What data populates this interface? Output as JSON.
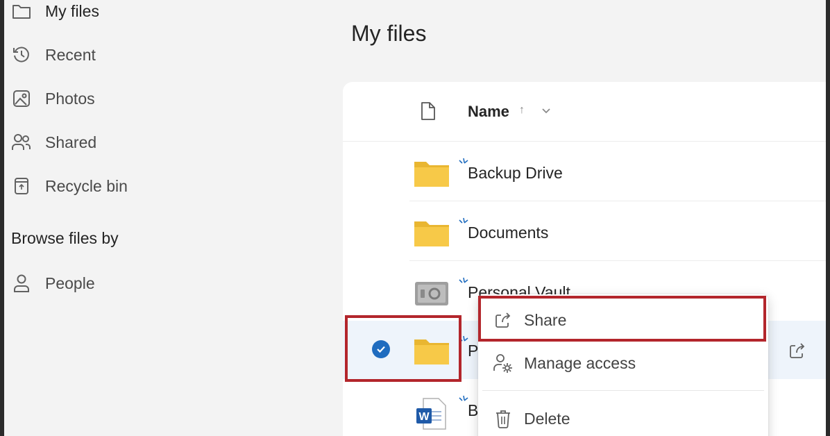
{
  "sidebar": {
    "items": [
      {
        "label": "My files",
        "icon": "folder-icon"
      },
      {
        "label": "Recent",
        "icon": "clock-icon"
      },
      {
        "label": "Photos",
        "icon": "image-icon"
      },
      {
        "label": "Shared",
        "icon": "people-icon"
      },
      {
        "label": "Recycle bin",
        "icon": "recycle-bin-icon"
      }
    ],
    "browse_heading": "Browse files by",
    "browse_items": [
      {
        "label": "People",
        "icon": "person-icon"
      }
    ]
  },
  "main": {
    "title": "My files",
    "columns": {
      "name": "Name",
      "sort_indicator": "↑"
    },
    "rows": [
      {
        "name": "Backup Drive",
        "type": "folder"
      },
      {
        "name": "Documents",
        "type": "folder"
      },
      {
        "name": "Personal Vault",
        "type": "vault"
      },
      {
        "name": "P",
        "type": "folder",
        "selected": true
      },
      {
        "name": "B",
        "type": "word-document"
      }
    ]
  },
  "context_menu": {
    "items": [
      {
        "label": "Share",
        "icon": "share-icon"
      },
      {
        "label": "Manage access",
        "icon": "manage-access-icon"
      },
      {
        "label": "Delete",
        "icon": "trash-icon"
      }
    ]
  },
  "colors": {
    "accent": "#1f6cbf",
    "folder": "#f7c948",
    "highlight_box": "#b3262c"
  }
}
